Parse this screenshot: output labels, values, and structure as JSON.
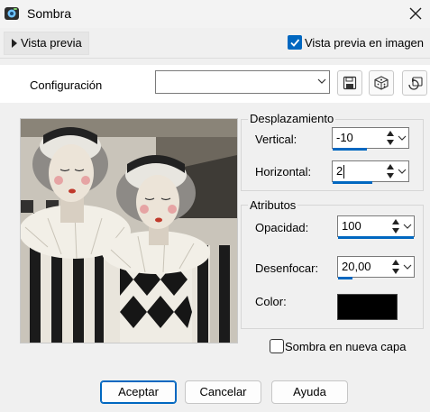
{
  "window": {
    "title": "Sombra"
  },
  "preview_bar": {
    "toggle_label": "Vista previa",
    "image_preview_label": "Vista previa en imagen",
    "image_preview_checked": true
  },
  "config": {
    "label": "Configuración",
    "value": ""
  },
  "offset": {
    "legend": "Desplazamiento",
    "vertical_label": "Vertical:",
    "vertical_value": "-10",
    "horizontal_label": "Horizontal:",
    "horizontal_value": "2"
  },
  "attributes": {
    "legend": "Atributos",
    "opacity_label": "Opacidad:",
    "opacity_value": "100",
    "blur_label": "Desenfocar:",
    "blur_value": "20,00",
    "color_label": "Color:",
    "color_value": "#000000"
  },
  "new_layer": {
    "label": "Sombra en nueva capa",
    "checked": false
  },
  "buttons": {
    "ok": "Aceptar",
    "cancel": "Cancelar",
    "help": "Ayuda"
  },
  "colors": {
    "accent": "#0067c0"
  },
  "icons": {
    "window": "app-icon",
    "close": "close-icon",
    "save": "floppy-disk-icon",
    "random": "dice-icon",
    "reset": "reset-preset-icon"
  }
}
